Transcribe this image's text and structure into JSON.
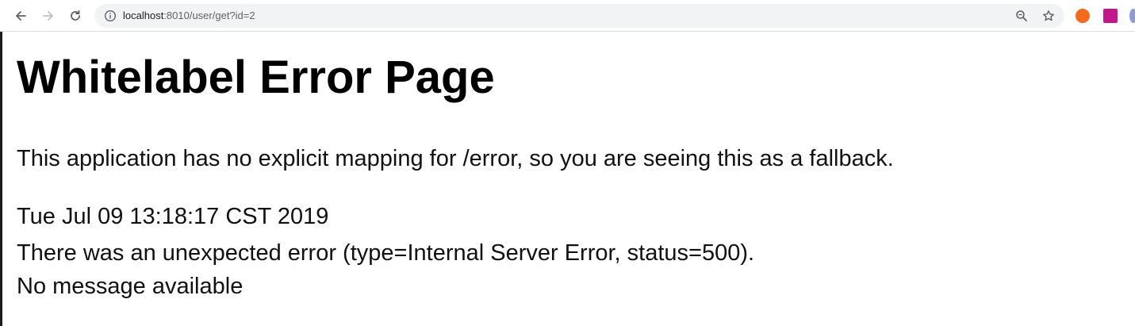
{
  "browser": {
    "url_host": "localhost",
    "url_rest": ":8010/user/get?id=2",
    "icons": {
      "back": "arrow-left-icon",
      "forward": "arrow-right-icon",
      "reload": "reload-icon",
      "info": "info-icon",
      "zoom": "zoom-icon",
      "bookmark": "star-icon"
    },
    "extension_colors": [
      "#f26b1d",
      "#c2188c",
      "#8e9bd6"
    ]
  },
  "page": {
    "title": "Whitelabel Error Page",
    "fallback_message": "This application has no explicit mapping for /error, so you are seeing this as a fallback.",
    "timestamp": "Tue Jul 09 13:18:17 CST 2019",
    "error_line": "There was an unexpected error (type=Internal Server Error, status=500).",
    "message_line": "No message available"
  }
}
